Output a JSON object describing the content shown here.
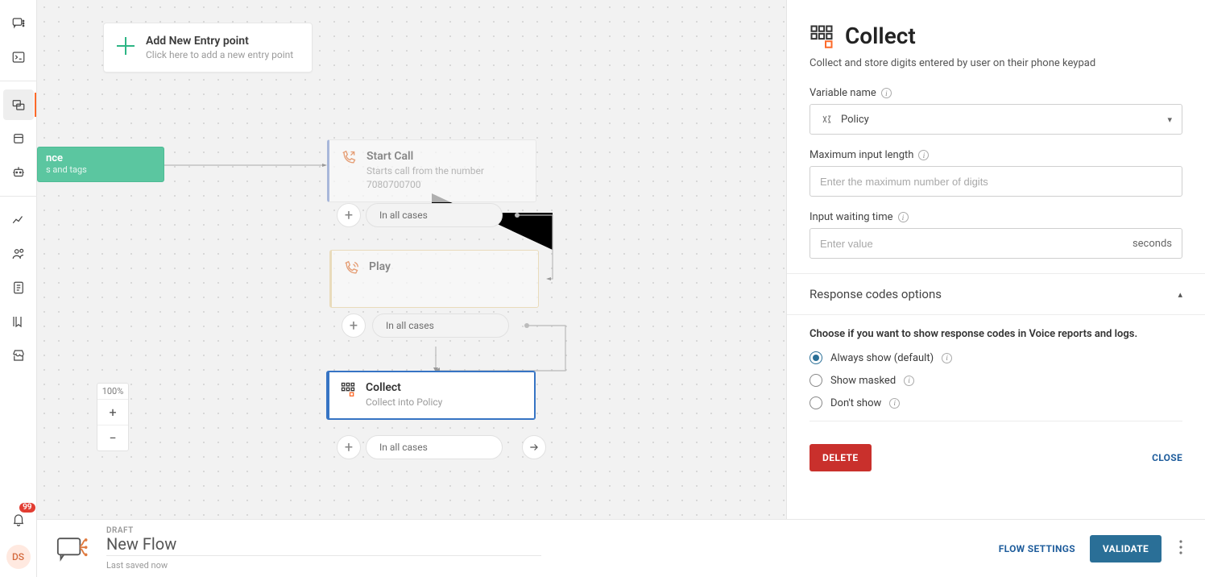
{
  "rail": {
    "notif_count": "99",
    "avatar": "DS"
  },
  "entry": {
    "title": "Add New Entry point",
    "subtitle": "Click here to add a new entry point"
  },
  "green_node": {
    "title_fragment": "nce",
    "subtitle_fragment": "s and tags"
  },
  "nodes": {
    "start_call": {
      "title": "Start Call",
      "sub": "Starts call from the number 7080700700"
    },
    "play": {
      "title": "Play"
    },
    "collect": {
      "title": "Collect",
      "sub": "Collect into Policy"
    }
  },
  "pill_label": "In all cases",
  "zoom": {
    "label": "100%"
  },
  "footer": {
    "status": "DRAFT",
    "title": "New Flow",
    "saved": "Last saved now",
    "settings": "FLOW SETTINGS",
    "validate": "VALIDATE"
  },
  "panel": {
    "title": "Collect",
    "description": "Collect and store digits entered by user on their phone keypad",
    "var_label": "Variable name",
    "var_value": "Policy",
    "max_label": "Maximum input length",
    "max_placeholder": "Enter the maximum number of digits",
    "wait_label": "Input waiting time",
    "wait_placeholder": "Enter value",
    "wait_suffix": "seconds",
    "collapse": "Response codes options",
    "rc_help": "Choose if you want to show response codes in Voice reports and logs.",
    "rc_options": {
      "always": "Always show (default)",
      "masked": "Show masked",
      "dont": "Don't show"
    },
    "delete": "DELETE",
    "close": "CLOSE"
  }
}
